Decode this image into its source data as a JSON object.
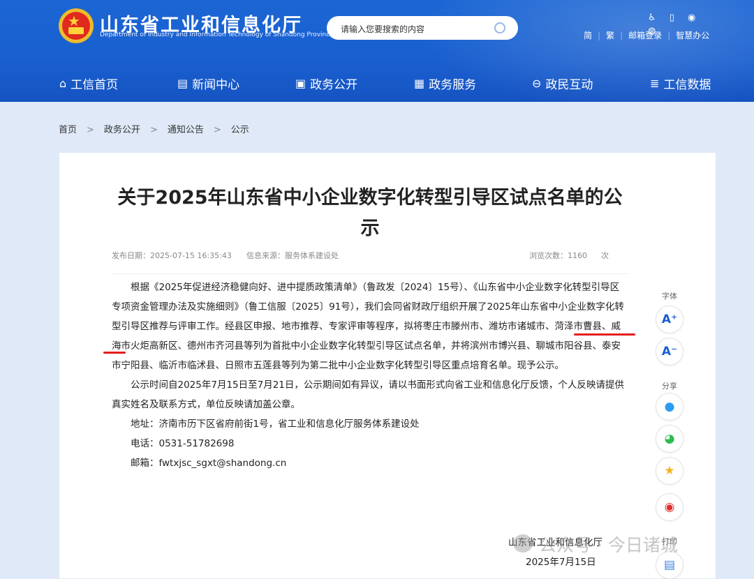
{
  "header": {
    "site_title": "山东省工业和信息化厅",
    "site_subtitle": "Department of Industry and Information Technology of Shandong Province",
    "search_placeholder": "请输入您要搜索的内容",
    "top_links": [
      "简",
      "繁",
      "邮箱登录",
      "智慧办公"
    ],
    "nav": [
      {
        "label": "工信首页",
        "icon": "home-icon"
      },
      {
        "label": "新闻中心",
        "icon": "news-icon"
      },
      {
        "label": "政务公开",
        "icon": "monitor-icon"
      },
      {
        "label": "政务服务",
        "icon": "service-icon"
      },
      {
        "label": "政民互动",
        "icon": "chat-icon"
      },
      {
        "label": "工信数据",
        "icon": "database-icon"
      }
    ]
  },
  "breadcrumb": [
    "首页",
    "政务公开",
    "通知公告",
    "公示"
  ],
  "breadcrumb_separator": ">",
  "article": {
    "title": "关于2025年山东省中小企业数字化转型引导区试点名单的公示",
    "publish_date": "发布日期：2025-07-15 16:35:43",
    "source": "信息来源：服务体系建设处",
    "views_label": "浏览次数：",
    "views": "1160",
    "views_unit": "次",
    "paragraphs": [
      "根据《2025年促进经济稳健向好、进中提质政策清单》（鲁政发〔2024〕15号）、《山东省中小企业数字化转型引导区专项资金管理办法及实施细则》（鲁工信服〔2025〕91号），我们会同省财政厅组织开展了2025年山东省中小企业数字化转型引导区推荐与评审工作。经县区申报、地市推荐、专家评审等程序，拟将枣庄市滕州市、潍坊市诸城市、菏泽市曹县、威海市火炬高新区、德州市齐河县等列为首批中小企业数字化转型引导区试点名单，并将滨州市博兴县、聊城市阳谷县、泰安市宁阳县、临沂市临沭县、日照市五莲县等列为第二批中小企业数字化转型引导区重点培育名单。现予公示。",
      "公示时间自2025年7月15日至7月21日，公示期间如有异议，请以书面形式向省工业和信息化厅反馈，个人反映请提供真实姓名及联系方式，单位反映请加盖公章。"
    ],
    "address": "地址：济南市历下区省府前街1号，省工业和信息化厅服务体系建设处",
    "phone": "电话：0531-51782698",
    "email": "邮箱：fwtxjsc_sgxt@shandong.cn",
    "signature_org": "山东省工业和信息化厅",
    "signature_date": "2025年7月15日"
  },
  "side_tools": {
    "font_label": "字体",
    "font_increase": "A⁺",
    "font_decrease": "A⁻",
    "share_label": "分享",
    "print_label": "打印",
    "share_icons": [
      "qq-icon",
      "wechat-icon",
      "qzone-icon",
      "weibo-icon"
    ]
  },
  "watermark": "公众号 · 今日诸城",
  "colors": {
    "header_blue": "#1a5fcf",
    "highlight_red": "#e51c1c"
  }
}
